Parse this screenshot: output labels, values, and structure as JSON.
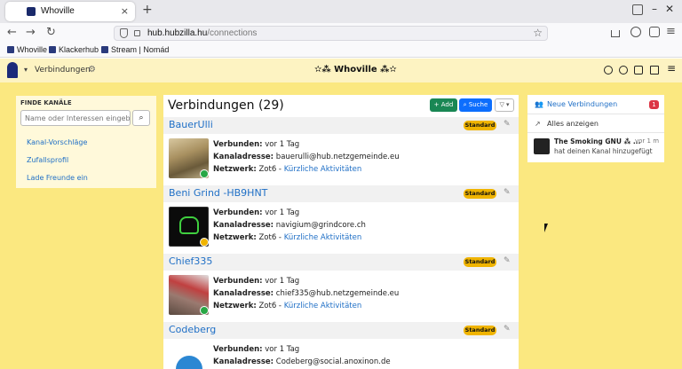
{
  "browser": {
    "tab_title": "Whoville",
    "new_tab_symbol": "+",
    "tab_close_symbol": "×",
    "url_host": "hub.hubzilla.hu",
    "url_path": "/connections",
    "bookmarks": [
      "Whoville",
      "Klackerhub",
      "Stream | Nomád"
    ]
  },
  "topnav": {
    "section_title": "Verbindungen",
    "site_name": "✫⁂ Whoville ⁂✫"
  },
  "left": {
    "heading": "FINDE KANÄLE",
    "search_placeholder": "Name oder Interessen eingeben",
    "links": [
      "Kanal-Vorschläge",
      "Zufallsprofil",
      "Lade Freunde ein"
    ]
  },
  "main": {
    "title": "Verbindungen (29)",
    "add_label": "+ Add",
    "search_label": "Suche",
    "filter_label": "▽ ▾",
    "labels": {
      "connected": "Verbunden:",
      "address": "Kanaladresse:",
      "network": "Netzwerk:"
    },
    "entries": [
      {
        "name": "BauerUlli",
        "badge": "Standard",
        "connected": "vor 1 Tag",
        "address": "bauerulli@hub.netzgemeinde.eu",
        "network": "Zot6",
        "activity": "Kürzliche Aktivitäten"
      },
      {
        "name": "Beni Grind -HB9HNT",
        "badge": "Standard",
        "connected": "vor 1 Tag",
        "address": "navigium@grindcore.ch",
        "network": "Zot6",
        "activity": "Kürzliche Aktivitäten"
      },
      {
        "name": "Chief335",
        "badge": "Standard",
        "connected": "vor 1 Tag",
        "address": "chief335@hub.netzgemeinde.eu",
        "network": "Zot6",
        "activity": "Kürzliche Aktivitäten"
      },
      {
        "name": "Codeberg",
        "badge": "Standard",
        "connected": "vor 1 Tag",
        "address": "Codeberg@social.anoxinon.de"
      }
    ]
  },
  "right": {
    "new_connections": "Neue Verbindungen",
    "new_count": "1",
    "show_all": "Alles anzeigen",
    "notif_name": "The Smoking GNU ⁂ ...",
    "notif_time": "vor 1 m",
    "notif_text": "hat deinen Kanal hinzugefügt"
  },
  "colors": {
    "page_bg": "#fbe880",
    "link": "#1f6fc6",
    "badge": "#f0b400",
    "online": "#28a745",
    "away": "#f0b400"
  }
}
